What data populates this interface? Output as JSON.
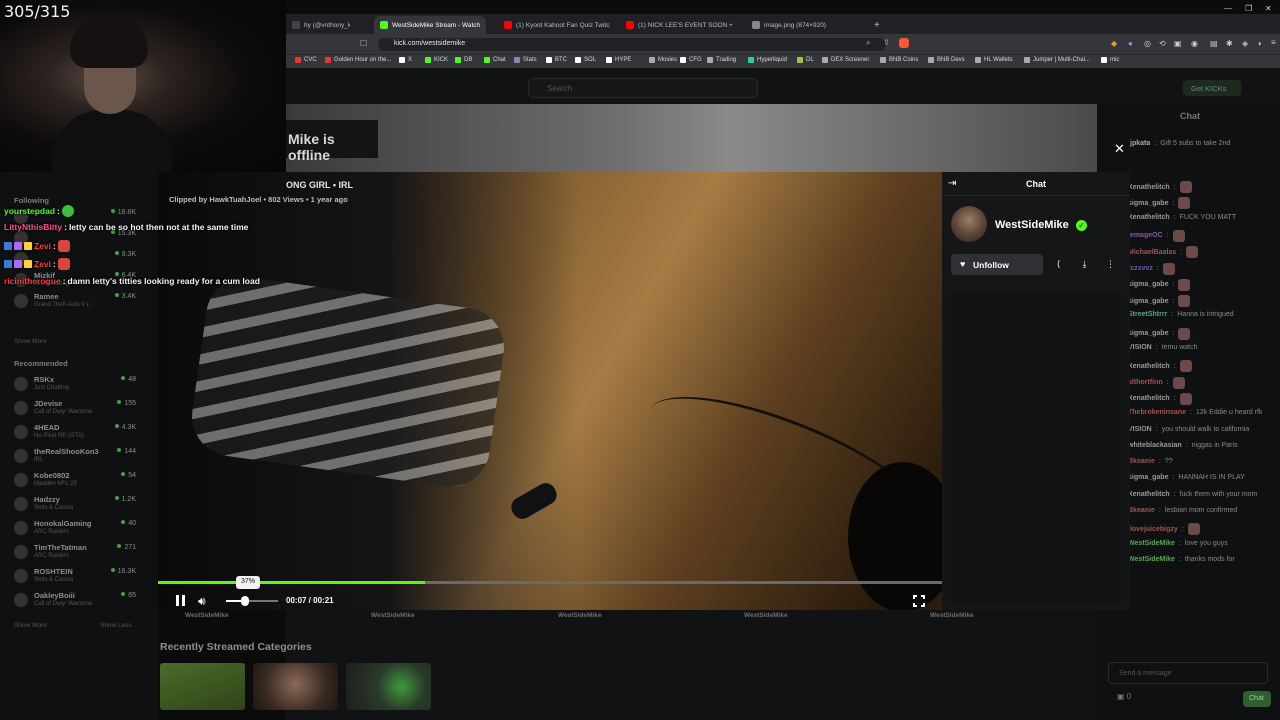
{
  "overlay": {
    "counter": "305/315"
  },
  "browser": {
    "tabs": [
      {
        "label": "hy (@vnthony_kickj) / X",
        "active": false,
        "color": "#444"
      },
      {
        "label": "WestSideMike Stream - Watch",
        "active": true,
        "color": "#53fc18"
      },
      {
        "label": "(1) Kyoot Kahoot Fan Quiz Twitch Sp",
        "active": false,
        "color": "#ff0000"
      },
      {
        "label": "(1) NICK LEE'S EVENT SOON + CLAV",
        "active": false,
        "color": "#ff0000"
      },
      {
        "label": "image.png (874×920)",
        "active": false,
        "color": "#888"
      }
    ],
    "new_tab": "+",
    "url": "kick.com/westsidemike",
    "bookmarks": [
      {
        "label": "CVC",
        "color": "#e33"
      },
      {
        "label": "Golden Hour on the...",
        "color": "#e33"
      },
      {
        "label": "X",
        "color": "#fff"
      },
      {
        "label": "KICK",
        "color": "#53fc18"
      },
      {
        "label": "DB",
        "color": "#53fc18"
      },
      {
        "label": "Chat",
        "color": "#53fc18"
      },
      {
        "label": "Stats",
        "color": "#88a"
      },
      {
        "label": "BTC",
        "color": "#fff"
      },
      {
        "label": "SOL",
        "color": "#fff"
      },
      {
        "label": "HYPE",
        "color": "#fff"
      },
      {
        "label": "Movies",
        "color": "#aaa"
      },
      {
        "label": "CFG",
        "color": "#fff"
      },
      {
        "label": "Trading",
        "color": "#aaa"
      },
      {
        "label": "Hyperliquid",
        "color": "#3c9"
      },
      {
        "label": "DL",
        "color": "#9c3"
      },
      {
        "label": "DEX Screener",
        "color": "#aaa"
      },
      {
        "label": "BNB Coins",
        "color": "#aaa"
      },
      {
        "label": "BNB Devs",
        "color": "#aaa"
      },
      {
        "label": "HL Wallets",
        "color": "#aaa"
      },
      {
        "label": "Jumper | Multi-Chai...",
        "color": "#aaa"
      },
      {
        "label": "mic",
        "color": "#fff"
      }
    ]
  },
  "kick": {
    "search_placeholder": "Search",
    "get_kicks": "Get KICKs",
    "offline_text": "Mike is offline",
    "bg_chat_title": "Chat",
    "bg_chat_input_placeholder": "Send a message",
    "bg_chat_button": "Chat",
    "bg_chat_count": "0",
    "recent_categories_title": "Recently Streamed Categories",
    "sidebar": {
      "following_label": "Following",
      "show_more": "Show More",
      "show_less": "Show Less",
      "recommended_label": "Recommended",
      "following_items": [
        {
          "name": "",
          "sub": "",
          "viewers": "18.8K"
        },
        {
          "name": "",
          "sub": "",
          "viewers": "15.3K"
        },
        {
          "name": "",
          "sub": "",
          "viewers": "9.3K"
        },
        {
          "name": "Mizkif",
          "sub": "Just Chatting",
          "viewers": "6.4K"
        },
        {
          "name": "Ramee",
          "sub": "Grand Theft Auto V (...",
          "viewers": "3.4K"
        }
      ],
      "recommended_items": [
        {
          "name": "RSKx",
          "sub": "Just Chatting",
          "viewers": "48"
        },
        {
          "name": "JDevise",
          "sub": "Call of Duty: Warzone",
          "viewers": "155"
        },
        {
          "name": "4HEAD",
          "sub": "No Pixel RP (GTA)",
          "viewers": "4.3K"
        },
        {
          "name": "theRealShooKon3",
          "sub": "IRL",
          "viewers": "144"
        },
        {
          "name": "Kobe0802",
          "sub": "Madden NFL 25",
          "viewers": "54"
        },
        {
          "name": "Hadzzy",
          "sub": "Slots & Casino",
          "viewers": "1.2K"
        },
        {
          "name": "HonokalGaming",
          "sub": "ARC Raiders",
          "viewers": "40"
        },
        {
          "name": "TimTheTatman",
          "sub": "ARC Raiders",
          "viewers": "271"
        },
        {
          "name": "ROSHTEIN",
          "sub": "Slots & Casino",
          "viewers": "16.3K"
        },
        {
          "name": "OakleyBoiii",
          "sub": "Call of Duty: Warzone",
          "viewers": "65"
        }
      ]
    },
    "bg_chat_messages": [
      {
        "user": "jpkata",
        "text": "Gift 5 subs to take 2nd",
        "color": "#aaa"
      },
      {
        "user": "Xenathelitch",
        "text": "",
        "color": "#9a9a9a"
      },
      {
        "user": "sigma_gabe",
        "text": "",
        "color": "#9a9a9a"
      },
      {
        "user": "Xenathelitch",
        "text": "FUCK YOU MATT",
        "color": "#9a9a9a"
      },
      {
        "user": "lemageOC",
        "text": "",
        "color": "#8a5aa8"
      },
      {
        "user": "MichaelBaalas",
        "text": "",
        "color": "#a05555"
      },
      {
        "user": "fczxvvz",
        "text": "",
        "color": "#6a5aa8"
      },
      {
        "user": "sigma_gabe",
        "text": "",
        "color": "#9a9a9a"
      },
      {
        "user": "sigma_gabe",
        "text": "",
        "color": "#9a9a9a"
      },
      {
        "user": "StreetShtrrr",
        "text": "Hanna is intrigued",
        "color": "#5aa87a"
      },
      {
        "user": "sigma_gabe",
        "text": "",
        "color": "#9a9a9a"
      },
      {
        "user": "VISION",
        "text": "temu watch",
        "color": "#9a9a9a"
      },
      {
        "user": "Xenathelitch",
        "text": "",
        "color": "#9a9a9a"
      },
      {
        "user": "althortfinn",
        "text": "",
        "color": "#a05555"
      },
      {
        "user": "Xenathelitch",
        "text": "",
        "color": "#9a9a9a"
      },
      {
        "user": "Thebrokeninsane",
        "text": "12k Eddie u heard rfk",
        "color": "#a05555"
      },
      {
        "user": "VISION",
        "text": "you should walk to california",
        "color": "#9a9a9a"
      },
      {
        "user": "whiteblackasian",
        "text": "niggas in Paris",
        "color": "#9a9a9a"
      },
      {
        "user": "Bkeanie",
        "text": "??",
        "color": "#a05555"
      },
      {
        "user": "sigma_gabe",
        "text": "HANNAH IS IN PLAY",
        "color": "#9a9a9a"
      },
      {
        "user": "Xenathelitch",
        "text": "fuck them with your mom",
        "color": "#9a9a9a"
      },
      {
        "user": "Bkeanie",
        "text": "lesbian mom confirmed",
        "color": "#a05555"
      },
      {
        "user": "Ilovejuicebigzy",
        "text": "",
        "color": "#a05555"
      },
      {
        "user": "WestSideMike",
        "text": "love you guys",
        "color": "#5aa85a"
      },
      {
        "user": "WestSideMike",
        "text": "thanks mods for",
        "color": "#5aa85a"
      }
    ]
  },
  "stream_chat_overlay": [
    {
      "user": "yourstepdad",
      "text": "",
      "user_color": "#53fc18"
    },
    {
      "user": "LittyNthisBitty",
      "text": "letty can be so hot then not at the same time",
      "user_color": "#ff4d8a"
    },
    {
      "user": "Zevi",
      "text": "",
      "user_color": "#ff3b3b"
    },
    {
      "user": "Zevi",
      "text": "",
      "user_color": "#ff3b3b"
    },
    {
      "user": "ricinitherogue",
      "text": "damn letty's titties looking ready for a cum load",
      "user_color": "#ff3b3b"
    }
  ],
  "clip": {
    "title": "ONG GIRL • IRL",
    "meta": "Clipped by HawkTuahJoel • 802 Views • 1 year ago",
    "progress_percent": 34,
    "volume_tooltip": "37%",
    "volume_level": 0.37,
    "time": "00:07 / 00:21",
    "watermarks": [
      "WestSideMike",
      "WestSideMike",
      "WestSideMike",
      "WestSideMike",
      "WestSideMike"
    ]
  },
  "modal_chat": {
    "title": "Chat",
    "streamer": "WestSideMike",
    "unfollow_label": "Unfollow"
  },
  "icons": {
    "close": "✕",
    "collapse": "⇥",
    "share": "⟨",
    "download": "⤓",
    "more": "⋮",
    "verified": "✓",
    "heart": "♥"
  },
  "colors": {
    "kick_green": "#53fc18"
  }
}
